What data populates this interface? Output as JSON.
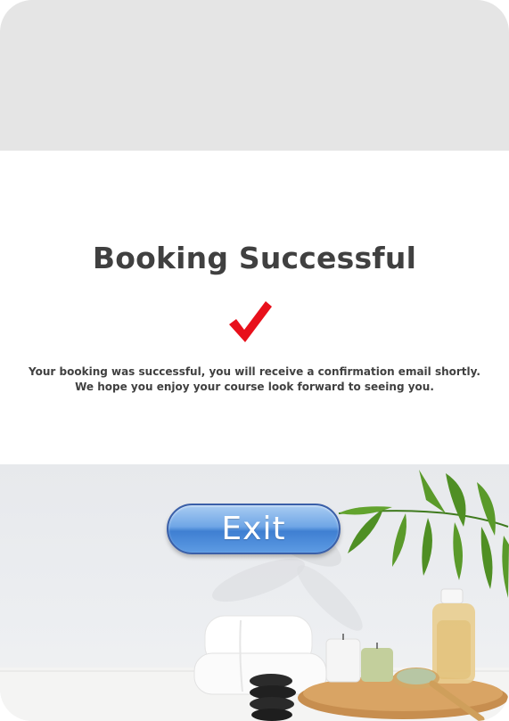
{
  "page": {
    "title": "Booking Successful",
    "message_lines": [
      "Your booking was successful, you will receive a confirmation email shortly.",
      "We hope you enjoy your course look forward to seeing you."
    ]
  },
  "exit_button": {
    "label": "Exit"
  },
  "colors": {
    "top_band": "#e5e5e5",
    "title_text": "#404040",
    "check_mark": "#e8101b",
    "button_blue": "#5d9be3"
  },
  "icons": {
    "check": "check-icon"
  }
}
